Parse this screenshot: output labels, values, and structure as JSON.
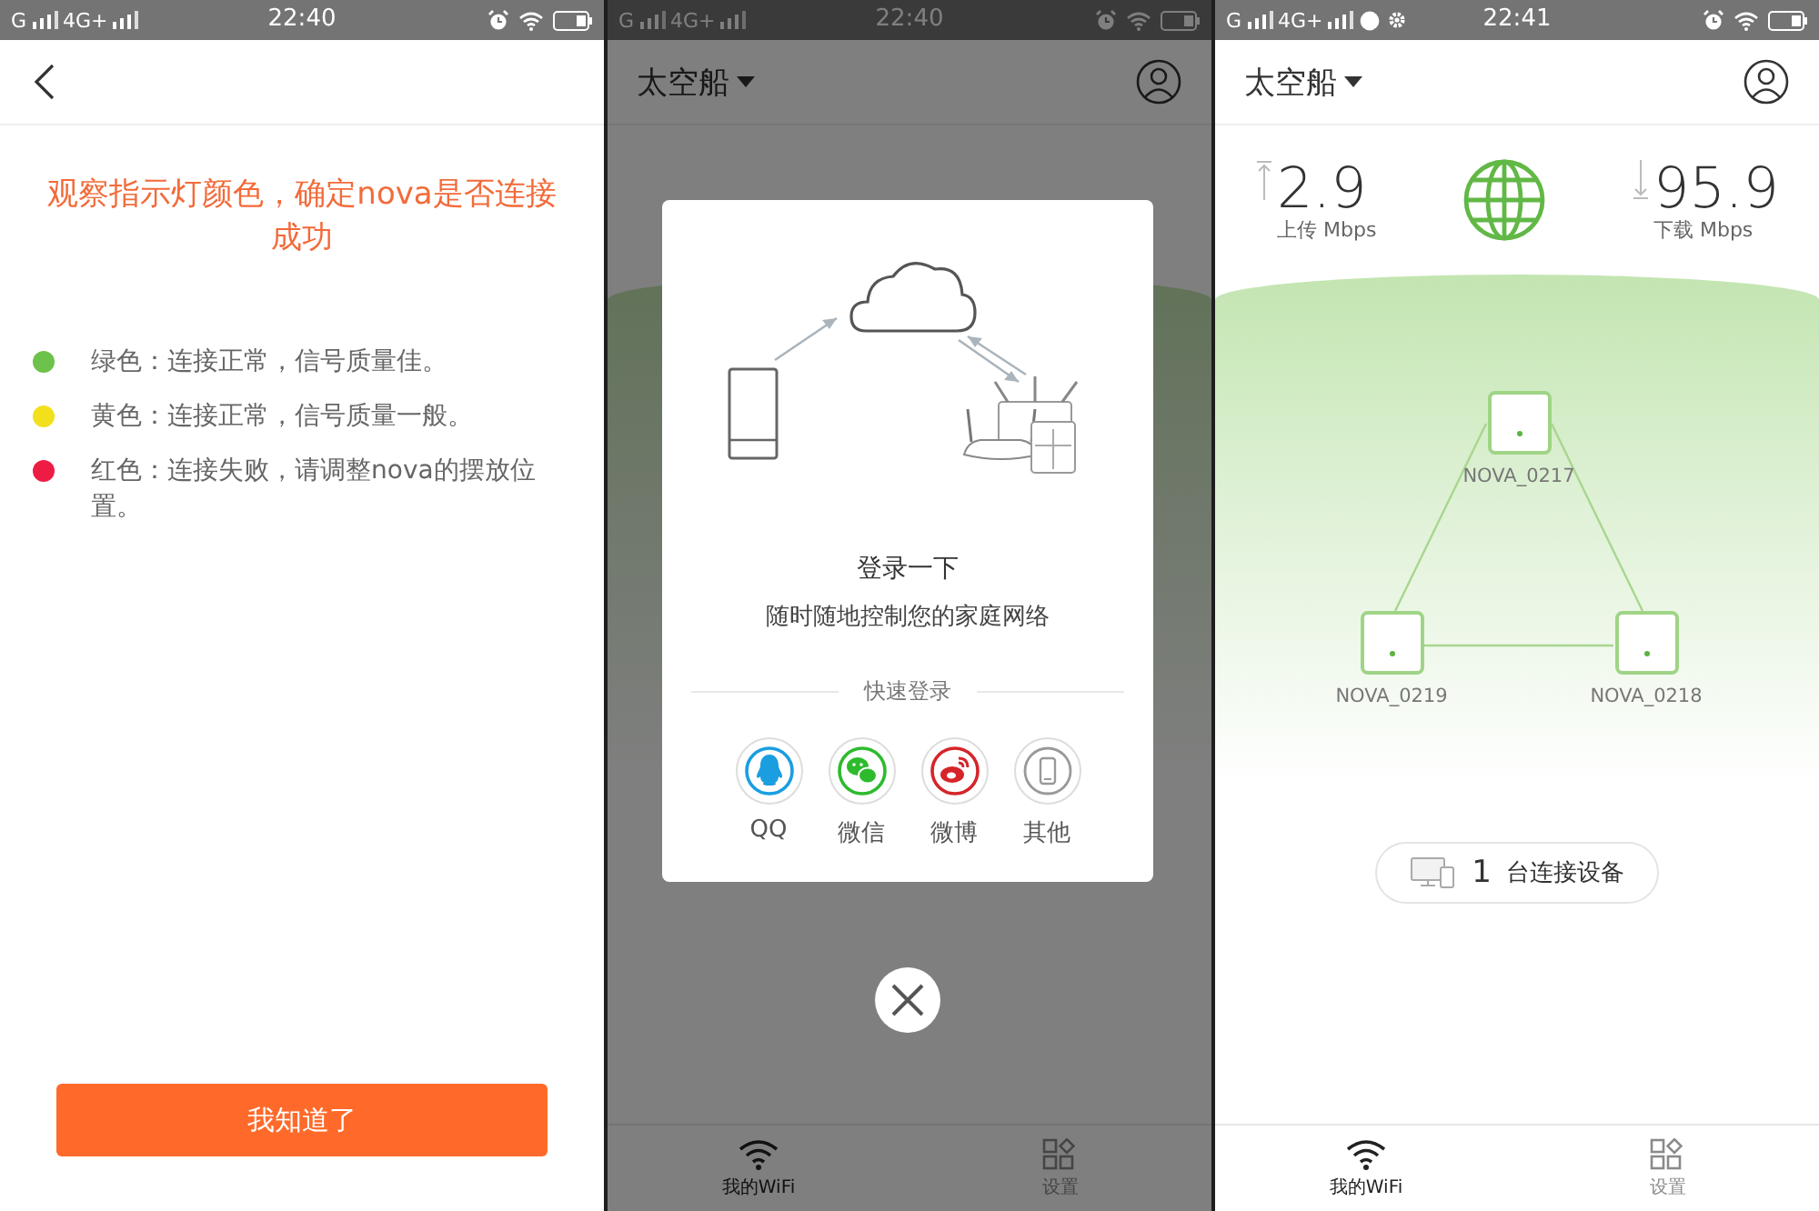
{
  "screens": [
    {
      "kind": "guide",
      "status_bar": {
        "carrier_1": "G",
        "carrier_2": "4G+",
        "time": "22:40"
      },
      "title": "观察指示灯颜色，确定nova是否连接成功",
      "legend": [
        {
          "color": "#6cc24a",
          "text": "绿色：连接正常，信号质量佳。"
        },
        {
          "color": "#f2e01c",
          "text": "黄色：连接正常，信号质量一般。"
        },
        {
          "color": "#ee1c44",
          "text": "红色：连接失败，请调整nova的摆放位置。"
        }
      ],
      "button": "我知道了"
    },
    {
      "kind": "login",
      "status_bar": {
        "carrier_1": "G",
        "carrier_2": "4G+",
        "time": "22:40"
      },
      "network_name": "太空船",
      "dialog": {
        "title": "登录一下",
        "subtitle": "随时随地控制您的家庭网络",
        "divider_label": "快速登录",
        "options": [
          {
            "kind": "qq",
            "label": "QQ"
          },
          {
            "kind": "wechat",
            "label": "微信"
          },
          {
            "kind": "weibo",
            "label": "微博"
          },
          {
            "kind": "other",
            "label": "其他"
          }
        ]
      },
      "tabs": [
        {
          "label": "我的WiFi",
          "selected": true
        },
        {
          "label": "设置",
          "selected": false
        }
      ]
    },
    {
      "kind": "home",
      "status_bar": {
        "carrier_1": "G",
        "carrier_2": "4G+",
        "time": "22:41",
        "has_notifications": true
      },
      "network_name": "太空船",
      "upload": {
        "value": "2.9",
        "label": "上传 Mbps"
      },
      "download": {
        "value": "95.9",
        "label": "下载 Mbps"
      },
      "nodes": [
        {
          "name": "NOVA_0217"
        },
        {
          "name": "NOVA_0219"
        },
        {
          "name": "NOVA_0218"
        }
      ],
      "connected": {
        "count": "1",
        "label": "台连接设备"
      },
      "tabs": [
        {
          "label": "我的WiFi",
          "selected": true
        },
        {
          "label": "设置",
          "selected": false
        }
      ]
    }
  ]
}
